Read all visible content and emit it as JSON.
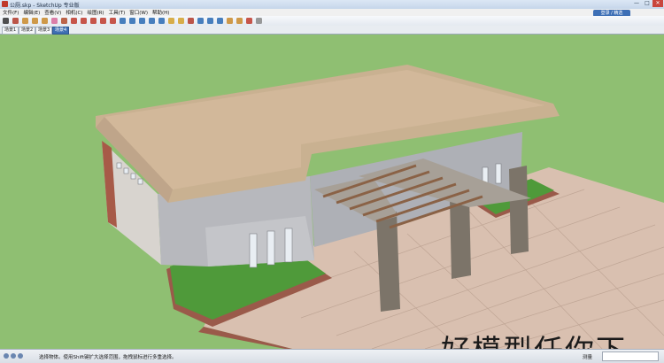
{
  "window": {
    "title": "公厕.skp - SketchUp 专业版",
    "minimize": "—",
    "maximize": "□",
    "close": "✕",
    "user_badge": "登录 / 精选"
  },
  "menu": [
    {
      "label": "文件(F)"
    },
    {
      "label": "编辑(E)"
    },
    {
      "label": "查看(V)"
    },
    {
      "label": "相机(C)"
    },
    {
      "label": "绘图(R)"
    },
    {
      "label": "工具(T)"
    },
    {
      "label": "窗口(W)"
    },
    {
      "label": "帮助(H)"
    }
  ],
  "toolbar": [
    {
      "icon": "select-arrow-icon",
      "color": "#333333"
    },
    {
      "icon": "line-pencil-icon",
      "color": "#b33a2a"
    },
    {
      "icon": "rectangle-icon",
      "color": "#c98a2a"
    },
    {
      "icon": "circle-icon",
      "color": "#c98a2a"
    },
    {
      "icon": "polygon-icon",
      "color": "#c98a2a"
    },
    {
      "icon": "eraser-icon",
      "color": "#d86a9a"
    },
    {
      "icon": "paint-bucket-icon",
      "color": "#b34a2a"
    },
    {
      "icon": "push-pull-icon",
      "color": "#c0392b"
    },
    {
      "icon": "move-icon",
      "color": "#c0392b"
    },
    {
      "icon": "rotate-icon",
      "color": "#c0392b"
    },
    {
      "icon": "offset-icon",
      "color": "#c0392b"
    },
    {
      "icon": "scale-icon",
      "color": "#c0392b"
    },
    {
      "icon": "orbit-icon",
      "color": "#2a6ab3"
    },
    {
      "icon": "pan-icon",
      "color": "#2a6ab3"
    },
    {
      "icon": "zoom-icon",
      "color": "#2a6ab3"
    },
    {
      "icon": "zoom-window-icon",
      "color": "#2a6ab3"
    },
    {
      "icon": "zoom-extents-icon",
      "color": "#2a6ab3"
    },
    {
      "icon": "tape-measure-icon",
      "color": "#d4a12a"
    },
    {
      "icon": "text-tool-icon",
      "color": "#d4a12a"
    },
    {
      "icon": "axes-icon",
      "color": "#b33a2a"
    },
    {
      "icon": "walk-icon",
      "color": "#2a6ab3"
    },
    {
      "icon": "position-camera-icon",
      "color": "#2a6ab3"
    },
    {
      "icon": "look-around-icon",
      "color": "#2a6ab3"
    },
    {
      "icon": "components-icon",
      "color": "#c98a2a"
    },
    {
      "icon": "warehouse-icon",
      "color": "#c98a2a"
    },
    {
      "icon": "extension-icon",
      "color": "#c0392b"
    },
    {
      "icon": "style-icon",
      "color": "#888888"
    }
  ],
  "scene_tabs": [
    {
      "label": "场景1",
      "active": false
    },
    {
      "label": "场景2",
      "active": false
    },
    {
      "label": "场景3",
      "active": false
    },
    {
      "label": "场景4",
      "active": true
    }
  ],
  "viewport": {
    "watermark_text": "好模型任你下",
    "colors": {
      "grass": "#8fbf72",
      "roof": "#d2b89a",
      "wall": "#b7b8bd",
      "brick_trim": "#9a5a4a",
      "pergola_beam": "#8a6246",
      "stone_column": "#7c7469",
      "paving": "#d9c0b0"
    }
  },
  "status": {
    "text": "选择物体。使用Shift键扩大选择范围，拖拽鼠标进行多重选择。",
    "measure_label": "测量",
    "measure_value": ""
  }
}
